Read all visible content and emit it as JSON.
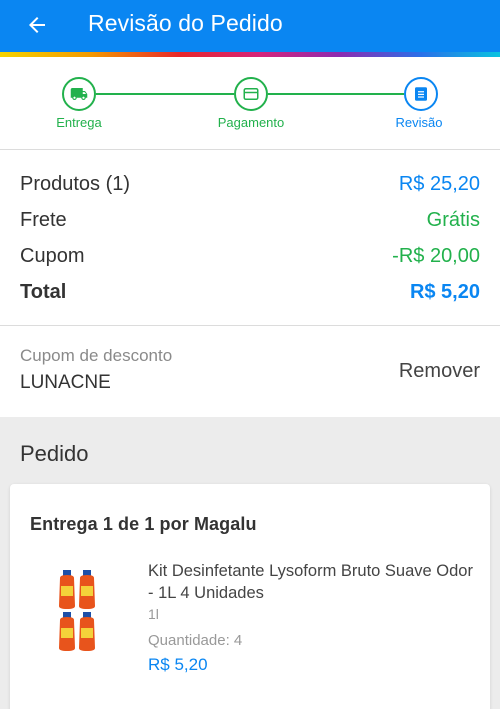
{
  "header": {
    "title": "Revisão do Pedido",
    "back_icon": "arrow-left-icon",
    "background_color": "#0a86f2"
  },
  "stepper": {
    "steps": [
      {
        "label": "Entrega",
        "icon": "truck-icon",
        "status": "done",
        "color": "#22b14c"
      },
      {
        "label": "Pagamento",
        "icon": "card-icon",
        "status": "done",
        "color": "#22b14c"
      },
      {
        "label": "Revisão",
        "icon": "list-icon",
        "status": "current",
        "color": "#0a86f2"
      }
    ]
  },
  "summary": {
    "products_label": "Produtos (1)",
    "products_value": "R$ 25,20",
    "shipping_label": "Frete",
    "shipping_value": "Grátis",
    "coupon_label": "Cupom",
    "coupon_value": "-R$ 20,00",
    "total_label": "Total",
    "total_value": "R$ 5,20"
  },
  "coupon": {
    "label": "Cupom de desconto",
    "code": "LUNACNE",
    "remove_label": "Remover"
  },
  "order": {
    "section_title": "Pedido",
    "delivery_title": "Entrega 1 de 1 por Magalu",
    "product": {
      "name": "Kit Desinfetante Lysoform Bruto Suave Odor - 1L 4 Unidades",
      "variant": "1l",
      "quantity_text": "Quantidade:  4",
      "price": "R$ 5,20"
    }
  }
}
